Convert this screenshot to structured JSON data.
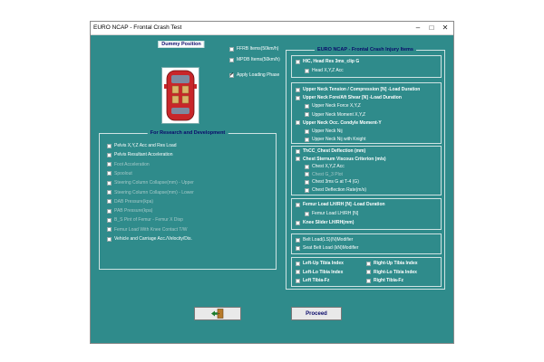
{
  "window": {
    "title": "EURO NCAP - Frontal Crash Test"
  },
  "dummy": {
    "title": "Dummy Position",
    "options": [
      {
        "label": "FFRB Items(50km/h)",
        "checked": false
      },
      {
        "label": "MPDB Items(50km/h)",
        "checked": false
      },
      {
        "label": "Apply Loading Phase",
        "checked": true
      }
    ]
  },
  "research": {
    "title": "For Research and Development",
    "items": [
      {
        "label": "Pelvis X,Y,Z Acc and Res Load",
        "enabled": true
      },
      {
        "label": "Pelvis Resultant Acceleration",
        "enabled": true
      },
      {
        "label": "Foot Acceleration",
        "enabled": false
      },
      {
        "label": "Spoolout",
        "enabled": false
      },
      {
        "label": "Steering Column Collapse(mm) - Upper",
        "enabled": false
      },
      {
        "label": "Steering Column Collapse(mm) - Lower",
        "enabled": false
      },
      {
        "label": "DAB Pressure(kpa)",
        "enabled": false
      },
      {
        "label": "PAB Pressure(kpa)",
        "enabled": false
      },
      {
        "label": "B_S Pint of Femur - Femur X Disp",
        "enabled": false
      },
      {
        "label": "Femur Load With Knee Contact T/W",
        "enabled": false
      },
      {
        "label": "Vehicle and Carriage Acc./Velocity/Dis.",
        "enabled": true
      }
    ]
  },
  "injury": {
    "title": "EURO NCAP - Frontal Crash Injury Items",
    "head": [
      {
        "label": "HIC, Head Res 3ms_clip G",
        "bold": true,
        "indent": 0
      },
      {
        "label": "Head X,Y,Z Acc",
        "bold": false,
        "indent": 1
      }
    ],
    "neck": [
      {
        "label": "Upper Neck Tension / Compression [N] -Load Duration",
        "bold": true,
        "indent": 0
      },
      {
        "label": "Upper Neck Fore/Aft Shear [N] -Load Duration",
        "bold": true,
        "indent": 0
      },
      {
        "label": "Upper Neck Force X,Y,Z",
        "bold": false,
        "indent": 1
      },
      {
        "label": "Upper Neck Moment X,Y,Z",
        "bold": false,
        "indent": 1
      },
      {
        "label": "Upper Neck Occ. Condyle Moment-Y",
        "bold": true,
        "indent": 0
      },
      {
        "label": "Upper Neck Nij",
        "bold": false,
        "indent": 1
      },
      {
        "label": "Upper Neck Nij with Knight",
        "bold": false,
        "indent": 1
      }
    ],
    "chest": [
      {
        "label": "ThCC_Chest Deflection (mm)",
        "bold": true,
        "indent": 0,
        "dim": false
      },
      {
        "label": "Chest Sternum Viscous Criterion (m/s)",
        "bold": true,
        "indent": 0,
        "dim": false
      },
      {
        "label": "Chest X,Y,Z Acc",
        "bold": false,
        "indent": 1,
        "dim": false
      },
      {
        "label": "Chest G_3 Plot",
        "bold": false,
        "indent": 1,
        "dim": true
      },
      {
        "label": "Chest 3ms G at T-4 (G)",
        "bold": false,
        "indent": 1,
        "dim": false
      },
      {
        "label": "Chest Deflection Rate(m/s)",
        "bold": false,
        "indent": 1,
        "dim": false
      }
    ],
    "femur": [
      {
        "label": "Femur Load LH/RH [N] -Load Duration",
        "bold": true,
        "indent": 0
      },
      {
        "label": "Femur Load LH/RH [N]",
        "bold": false,
        "indent": 1
      },
      {
        "label": "Knee Slider LH/RH(mm)",
        "bold": true,
        "indent": 0
      }
    ],
    "belt": [
      {
        "label": "Belt Load(LS)(N)Modifier",
        "bold": false,
        "indent": 0
      },
      {
        "label": "Seat Belt Load (kN)Modifier",
        "bold": false,
        "indent": 0
      }
    ],
    "tibia_left": [
      {
        "label": "Left-Up Tibia Index"
      },
      {
        "label": "Left-Lo Tibia Index"
      },
      {
        "label": "Left Tibia-Fz"
      }
    ],
    "tibia_right": [
      {
        "label": "Right-Up Tibia Index"
      },
      {
        "label": "Right-Lo Tibia Index"
      },
      {
        "label": "Right Tibia-Fz"
      }
    ]
  },
  "buttons": {
    "proceed": "Proceed",
    "exit_icon": "exit-door-icon"
  },
  "colors": {
    "background": "#2f8b8b",
    "title_text": "#0a0a6a"
  }
}
